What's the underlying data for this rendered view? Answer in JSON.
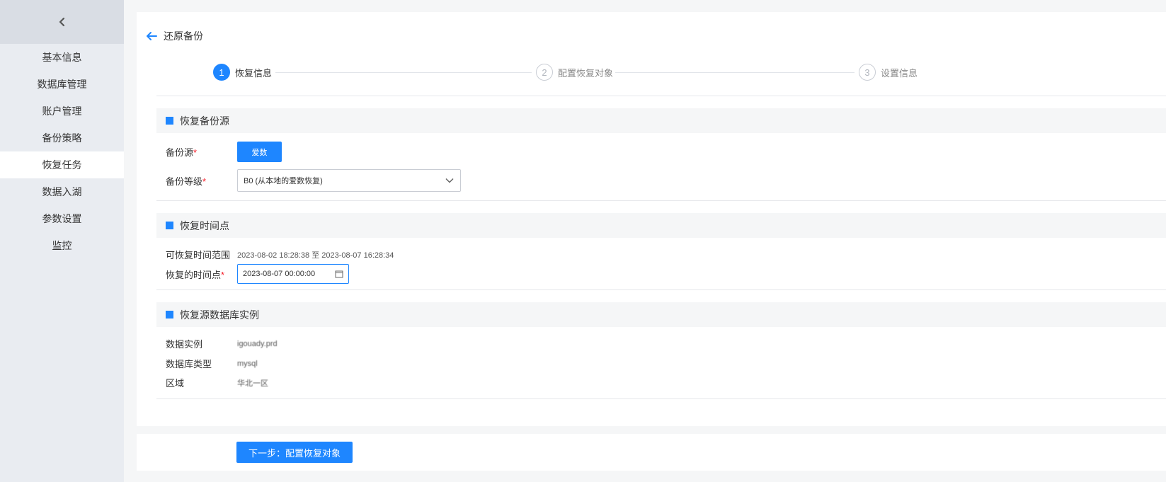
{
  "sidebar": {
    "collapse_icon": "chevron-left-icon",
    "items": [
      {
        "label": "基本信息"
      },
      {
        "label": "数据库管理"
      },
      {
        "label": "账户管理"
      },
      {
        "label": "备份策略"
      },
      {
        "label": "恢复任务",
        "active": true
      },
      {
        "label": "数据入湖"
      },
      {
        "label": "参数设置"
      },
      {
        "label": "监控"
      }
    ]
  },
  "header": {
    "back_icon": "arrow-left-icon",
    "title": "还原备份"
  },
  "steps": [
    {
      "num": "1",
      "label": "恢复信息",
      "active": true
    },
    {
      "num": "2",
      "label": "配置恢复对象"
    },
    {
      "num": "3",
      "label": "设置信息"
    }
  ],
  "sections": {
    "source": {
      "title": "恢复备份源",
      "source_label": "备份源",
      "source_button": "爱数",
      "level_label": "备份等级",
      "level_value": "B0 (从本地的爱数恢复)"
    },
    "time": {
      "title": "恢复时间点",
      "range_label": "可恢复时间范围",
      "range_value": "2023-08-02 18:28:38 至 2023-08-07 16:28:34",
      "point_label": "恢复的时间点",
      "point_value": "2023-08-07 00:00:00"
    },
    "instance": {
      "title": "恢复源数据库实例",
      "instance_label": "数据实例",
      "instance_value": "igouady.prd",
      "dbtype_label": "数据库类型",
      "dbtype_value": "mysql",
      "region_label": "区域",
      "region_value": "华北一区"
    }
  },
  "footer": {
    "next_label": "下一步：配置恢复对象"
  },
  "colors": {
    "accent": "#1e86ff",
    "required": "#f5222d"
  }
}
